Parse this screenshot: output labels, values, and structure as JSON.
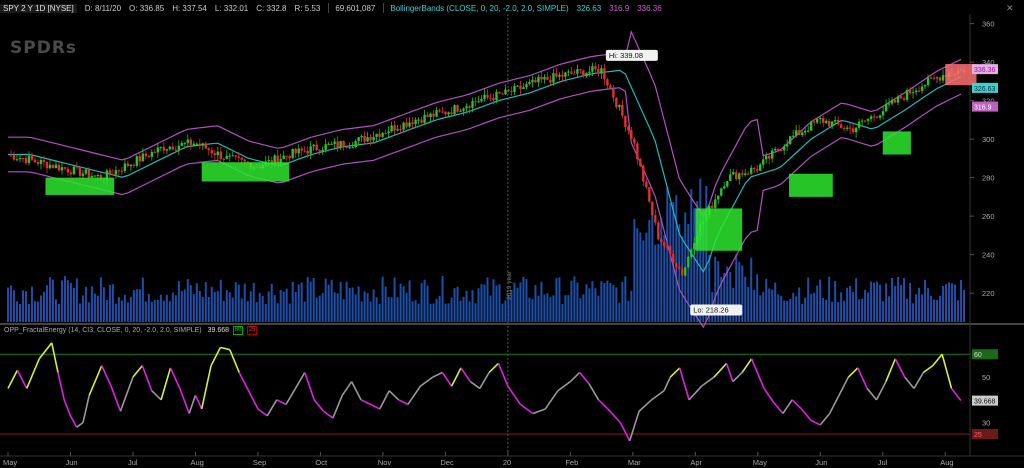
{
  "header": {
    "symbol": "SPY 2 Y 1D [NYSE]",
    "date": "D: 8/11/20",
    "open": "O: 336.85",
    "high": "H: 337.54",
    "low": "L: 332.01",
    "close": "C: 332.8",
    "range": "R: 5.53",
    "volume": "69,601,087",
    "bb_label": "BollingerBands (CLOSE, 0, 20, -2.0, 2.0, SIMPLE)",
    "bb_mid": "326.63",
    "bb_low": "316.9",
    "bb_up": "336.36"
  },
  "logo": "SPDRs",
  "indicator": {
    "label": "OPP_FractalEnergy (14, CI3, CLOSE, 0, 20, -2.0, 2.0, SIMPLE)",
    "value": "39.668",
    "box1": "60",
    "box2": "25"
  },
  "annotations": {
    "hi": "Hi: 339.08",
    "lo": "Lo: 218.26",
    "year": "2019 year"
  },
  "price_axis": [
    "360",
    "340",
    "320",
    "300",
    "280",
    "260",
    "240",
    "220"
  ],
  "price_tags": {
    "up": "336.36",
    "mid": "326.63",
    "low": "316.9"
  },
  "ind_axis": [
    "60",
    "50",
    "40",
    "30",
    "25"
  ],
  "ind_tag": "39.668",
  "ind_tag_60": "60",
  "ind_tag_25": "25",
  "months": [
    "May",
    "Jun",
    "Jul",
    "Aug",
    "Sep",
    "Oct",
    "Nov",
    "Dec",
    "20",
    "Feb",
    "Mar",
    "Apr",
    "May",
    "Jun",
    "Jul",
    "Aug"
  ],
  "colors": {
    "bull": "#29c329",
    "bear": "#e03030",
    "mid_band": "#20b8b8",
    "outer_band": "#b050c0",
    "volume": "#1d4fa8",
    "fe_gray": "#999999",
    "fe_magenta": "#e020e0",
    "fe_yellow": "#d8f030",
    "green_box": "#2ee62e",
    "red_box": "#ff7070"
  },
  "chart_data": {
    "type": "candlestick",
    "x": [
      "May",
      "Jun",
      "Jul",
      "Aug",
      "Sep",
      "Oct",
      "Nov",
      "Dec",
      "20",
      "Feb",
      "Mar",
      "Apr",
      "May",
      "Jun",
      "Jul",
      "Aug"
    ],
    "close_path": [
      [
        0,
        292
      ],
      [
        0.5,
        288
      ],
      [
        1,
        284
      ],
      [
        1.5,
        280
      ],
      [
        2,
        288
      ],
      [
        2.5,
        296
      ],
      [
        3,
        298
      ],
      [
        3.5,
        290
      ],
      [
        4,
        286
      ],
      [
        4.5,
        292
      ],
      [
        5,
        296
      ],
      [
        5.5,
        298
      ],
      [
        6,
        304
      ],
      [
        6.5,
        310
      ],
      [
        7,
        314
      ],
      [
        7.5,
        320
      ],
      [
        8,
        324
      ],
      [
        8.5,
        330
      ],
      [
        9,
        334
      ],
      [
        9.5,
        336
      ],
      [
        10,
        300
      ],
      [
        10.4,
        250
      ],
      [
        10.8,
        230
      ],
      [
        11,
        250
      ],
      [
        11.5,
        280
      ],
      [
        12,
        285
      ],
      [
        12.5,
        300
      ],
      [
        13,
        310
      ],
      [
        13.5,
        305
      ],
      [
        14,
        315
      ],
      [
        14.5,
        326
      ],
      [
        15,
        334
      ],
      [
        15.3,
        336
      ]
    ],
    "ylim": [
      205,
      365
    ],
    "ind_path": [
      [
        0,
        45
      ],
      [
        0.15,
        53
      ],
      [
        0.3,
        45
      ],
      [
        0.5,
        58
      ],
      [
        0.7,
        65
      ],
      [
        0.8,
        52
      ],
      [
        0.9,
        40
      ],
      [
        1.0,
        33
      ],
      [
        1.1,
        28
      ],
      [
        1.2,
        30
      ],
      [
        1.3,
        42
      ],
      [
        1.5,
        55
      ],
      [
        1.65,
        46
      ],
      [
        1.8,
        35
      ],
      [
        2.0,
        50
      ],
      [
        2.15,
        55
      ],
      [
        2.3,
        44
      ],
      [
        2.45,
        40
      ],
      [
        2.6,
        54
      ],
      [
        2.75,
        45
      ],
      [
        2.9,
        34
      ],
      [
        3.0,
        42
      ],
      [
        3.1,
        36
      ],
      [
        3.25,
        55
      ],
      [
        3.4,
        63
      ],
      [
        3.55,
        62
      ],
      [
        3.7,
        52
      ],
      [
        3.85,
        44
      ],
      [
        4.0,
        36
      ],
      [
        4.15,
        33
      ],
      [
        4.3,
        40
      ],
      [
        4.45,
        38
      ],
      [
        4.6,
        45
      ],
      [
        4.75,
        52
      ],
      [
        4.9,
        40
      ],
      [
        5.05,
        35
      ],
      [
        5.2,
        32
      ],
      [
        5.35,
        42
      ],
      [
        5.5,
        48
      ],
      [
        5.65,
        40
      ],
      [
        5.8,
        38
      ],
      [
        5.95,
        36
      ],
      [
        6.1,
        44
      ],
      [
        6.25,
        40
      ],
      [
        6.4,
        38
      ],
      [
        6.6,
        46
      ],
      [
        6.8,
        50
      ],
      [
        6.95,
        52
      ],
      [
        7.1,
        46
      ],
      [
        7.25,
        54
      ],
      [
        7.4,
        48
      ],
      [
        7.55,
        45
      ],
      [
        7.7,
        52
      ],
      [
        7.85,
        56
      ],
      [
        8.0,
        46
      ],
      [
        8.2,
        38
      ],
      [
        8.4,
        34
      ],
      [
        8.6,
        36
      ],
      [
        8.8,
        44
      ],
      [
        9.0,
        48
      ],
      [
        9.15,
        52
      ],
      [
        9.3,
        47
      ],
      [
        9.45,
        40
      ],
      [
        9.6,
        36
      ],
      [
        9.8,
        30
      ],
      [
        9.95,
        22
      ],
      [
        10.1,
        35
      ],
      [
        10.3,
        40
      ],
      [
        10.5,
        44
      ],
      [
        10.6,
        50
      ],
      [
        10.75,
        54
      ],
      [
        10.9,
        40
      ],
      [
        11.1,
        46
      ],
      [
        11.3,
        50
      ],
      [
        11.5,
        56
      ],
      [
        11.6,
        48
      ],
      [
        11.75,
        52
      ],
      [
        11.9,
        58
      ],
      [
        12.1,
        45
      ],
      [
        12.25,
        39
      ],
      [
        12.4,
        34
      ],
      [
        12.55,
        40
      ],
      [
        12.7,
        36
      ],
      [
        12.85,
        31
      ],
      [
        13.0,
        29
      ],
      [
        13.15,
        34
      ],
      [
        13.3,
        42
      ],
      [
        13.45,
        50
      ],
      [
        13.6,
        54
      ],
      [
        13.75,
        45
      ],
      [
        13.9,
        40
      ],
      [
        14.05,
        48
      ],
      [
        14.2,
        58
      ],
      [
        14.35,
        50
      ],
      [
        14.5,
        45
      ],
      [
        14.65,
        52
      ],
      [
        14.8,
        55
      ],
      [
        14.95,
        60
      ],
      [
        15.1,
        45
      ],
      [
        15.25,
        39.7
      ]
    ],
    "ind_ylim": [
      18,
      68
    ],
    "hi": 339.08,
    "lo": 218.26
  }
}
